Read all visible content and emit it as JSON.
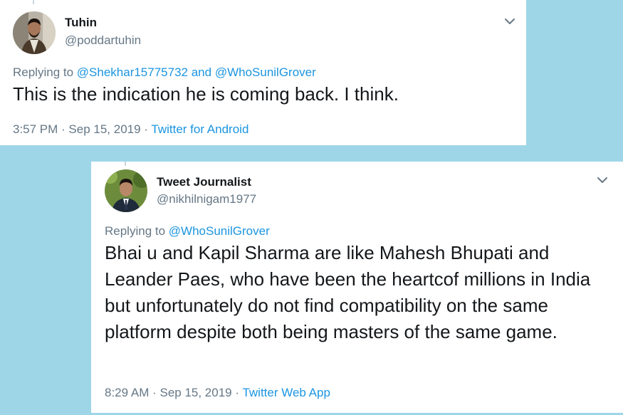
{
  "tweets": [
    {
      "name": "Tuhin",
      "handle": "@poddartuhin",
      "replying_prefix": "Replying to ",
      "reply_to": [
        "@Shekhar15775732",
        "@WhoSunilGrover"
      ],
      "reply_joiner": " and ",
      "text": "This is the indication he is coming back. I think.",
      "time": "3:57 PM",
      "date": "Sep 15, 2019",
      "source": "Twitter for Android",
      "caret_icon": "chevron-down-icon"
    },
    {
      "name": "Tweet Journalist",
      "handle": "@nikhilnigam1977",
      "replying_prefix": "Replying to ",
      "reply_to": [
        "@WhoSunilGrover"
      ],
      "text": "Bhai u and Kapil Sharma are like Mahesh Bhupati and Leander Paes, who have been the heartcof millions in India but unfortunately do not find compatibility on the same platform despite both being masters of the same game.",
      "time": "8:29 AM",
      "date": "Sep 15, 2019",
      "source": "Twitter Web App",
      "caret_icon": "chevron-down-icon"
    }
  ],
  "separator": " · ",
  "colors": {
    "background": "#9ed6e8",
    "link": "#1b95e0",
    "muted": "#657786",
    "text": "#14171a"
  }
}
